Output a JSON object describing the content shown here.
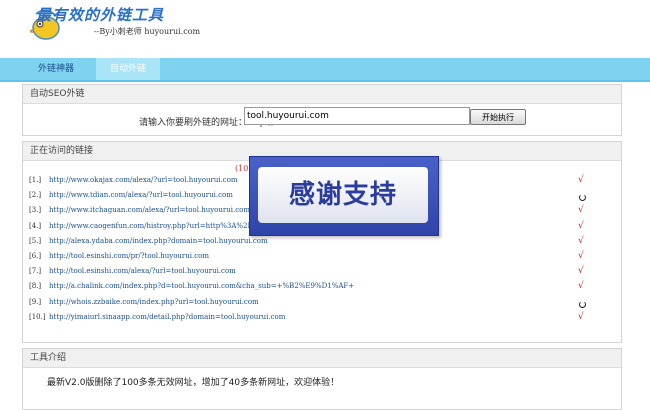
{
  "header": {
    "title": "最有效的外链工具",
    "subtitle": "--By小刺老师  huyourui.com"
  },
  "nav": {
    "items": [
      {
        "label": "外链神器"
      },
      {
        "label": "自动外链"
      }
    ]
  },
  "seo_panel": {
    "title": "自动SEO外链",
    "url_label": "请输入你要刷外链的网址：http://",
    "url_value": "tool.huyourui.com",
    "submit_label": "开始执行"
  },
  "links_panel": {
    "title": "正在访问的链接",
    "counter": "(10",
    "items": [
      {
        "index": "[1.]",
        "url": "http://www.okajax.com/alexa/?url=tool.huyourui.com",
        "status": "done"
      },
      {
        "index": "[2.]",
        "url": "http://www.tdian.com/alexa/?url=tool.huyourui.com",
        "status": "loading"
      },
      {
        "index": "[3.]",
        "url": "http://www.itchaguan.com/alexa/?url=tool.huyourui.com",
        "status": "done"
      },
      {
        "index": "[4.]",
        "url": "http://www.caogenfun.com/histroy.php?url=http%3A%2F%2Ftool.huyourui.com",
        "status": "done"
      },
      {
        "index": "[5.]",
        "url": "http://alexa.ydaba.com/index.php?domain=tool.huyourui.com",
        "status": "done"
      },
      {
        "index": "[6.]",
        "url": "http://tool.esinshi.com/pr/?tool.huyourui.com",
        "status": "done"
      },
      {
        "index": "[7.]",
        "url": "http://tool.esinshi.com/alexa/?url=tool.huyourui.com",
        "status": "done"
      },
      {
        "index": "[8.]",
        "url": "http://a.chalink.com/index.php?d=tool.huyourui.com&cha_sub=+%B2%E9%D1%AF+",
        "status": "done"
      },
      {
        "index": "[9.]",
        "url": "http://whois.zzbaike.com/index.php?url=tool.huyourui.com",
        "status": "loading"
      },
      {
        "index": "[10.]",
        "url": "http://yimaiurl.sinaapp.com/detail.php?domain=tool.huyourui.com",
        "status": "done"
      }
    ],
    "done_mark": "√"
  },
  "popup": {
    "text": "感谢支持"
  },
  "intro_panel": {
    "title": "工具介绍",
    "text": "最新V2.0版删除了100多条无效网址，增加了40多条新网址，欢迎体验！"
  },
  "colors": {
    "nav": "#7fd3f0",
    "link": "#1a4f8a",
    "done": "#cc2222",
    "popup": "#2e44a8"
  }
}
